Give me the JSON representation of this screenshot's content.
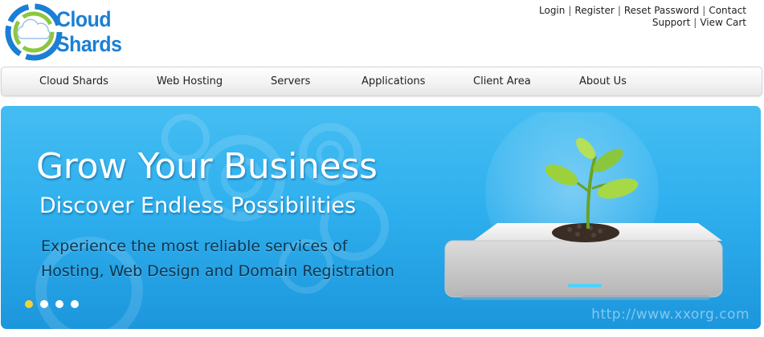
{
  "brand": {
    "name": "Cloud Shards"
  },
  "top_links": [
    {
      "label": "Login"
    },
    {
      "label": "Register"
    },
    {
      "label": "Reset Password"
    },
    {
      "label": "Contact Support"
    },
    {
      "label": "View Cart"
    }
  ],
  "nav": [
    {
      "label": "Cloud Shards"
    },
    {
      "label": "Web Hosting"
    },
    {
      "label": "Servers"
    },
    {
      "label": "Applications"
    },
    {
      "label": "Client Area"
    },
    {
      "label": "About Us"
    }
  ],
  "banner": {
    "headline": "Grow Your Business",
    "subheadline": "Discover Endless Possibilities",
    "tagline_line1": "Experience the most reliable services of",
    "tagline_line2": "Hosting, Web Design and Domain Registration",
    "slides_total": 4,
    "active_slide": 1,
    "watermark": "http://www.xxorg.com",
    "hero_icon": "plant-server-illustration"
  },
  "colors": {
    "brand_blue": "#1b7fd4",
    "logo_green": "#8cc63f",
    "banner_blue": "#2fb0ee",
    "active_dot": "#f0d23c",
    "tagline_text": "#0d3550"
  }
}
